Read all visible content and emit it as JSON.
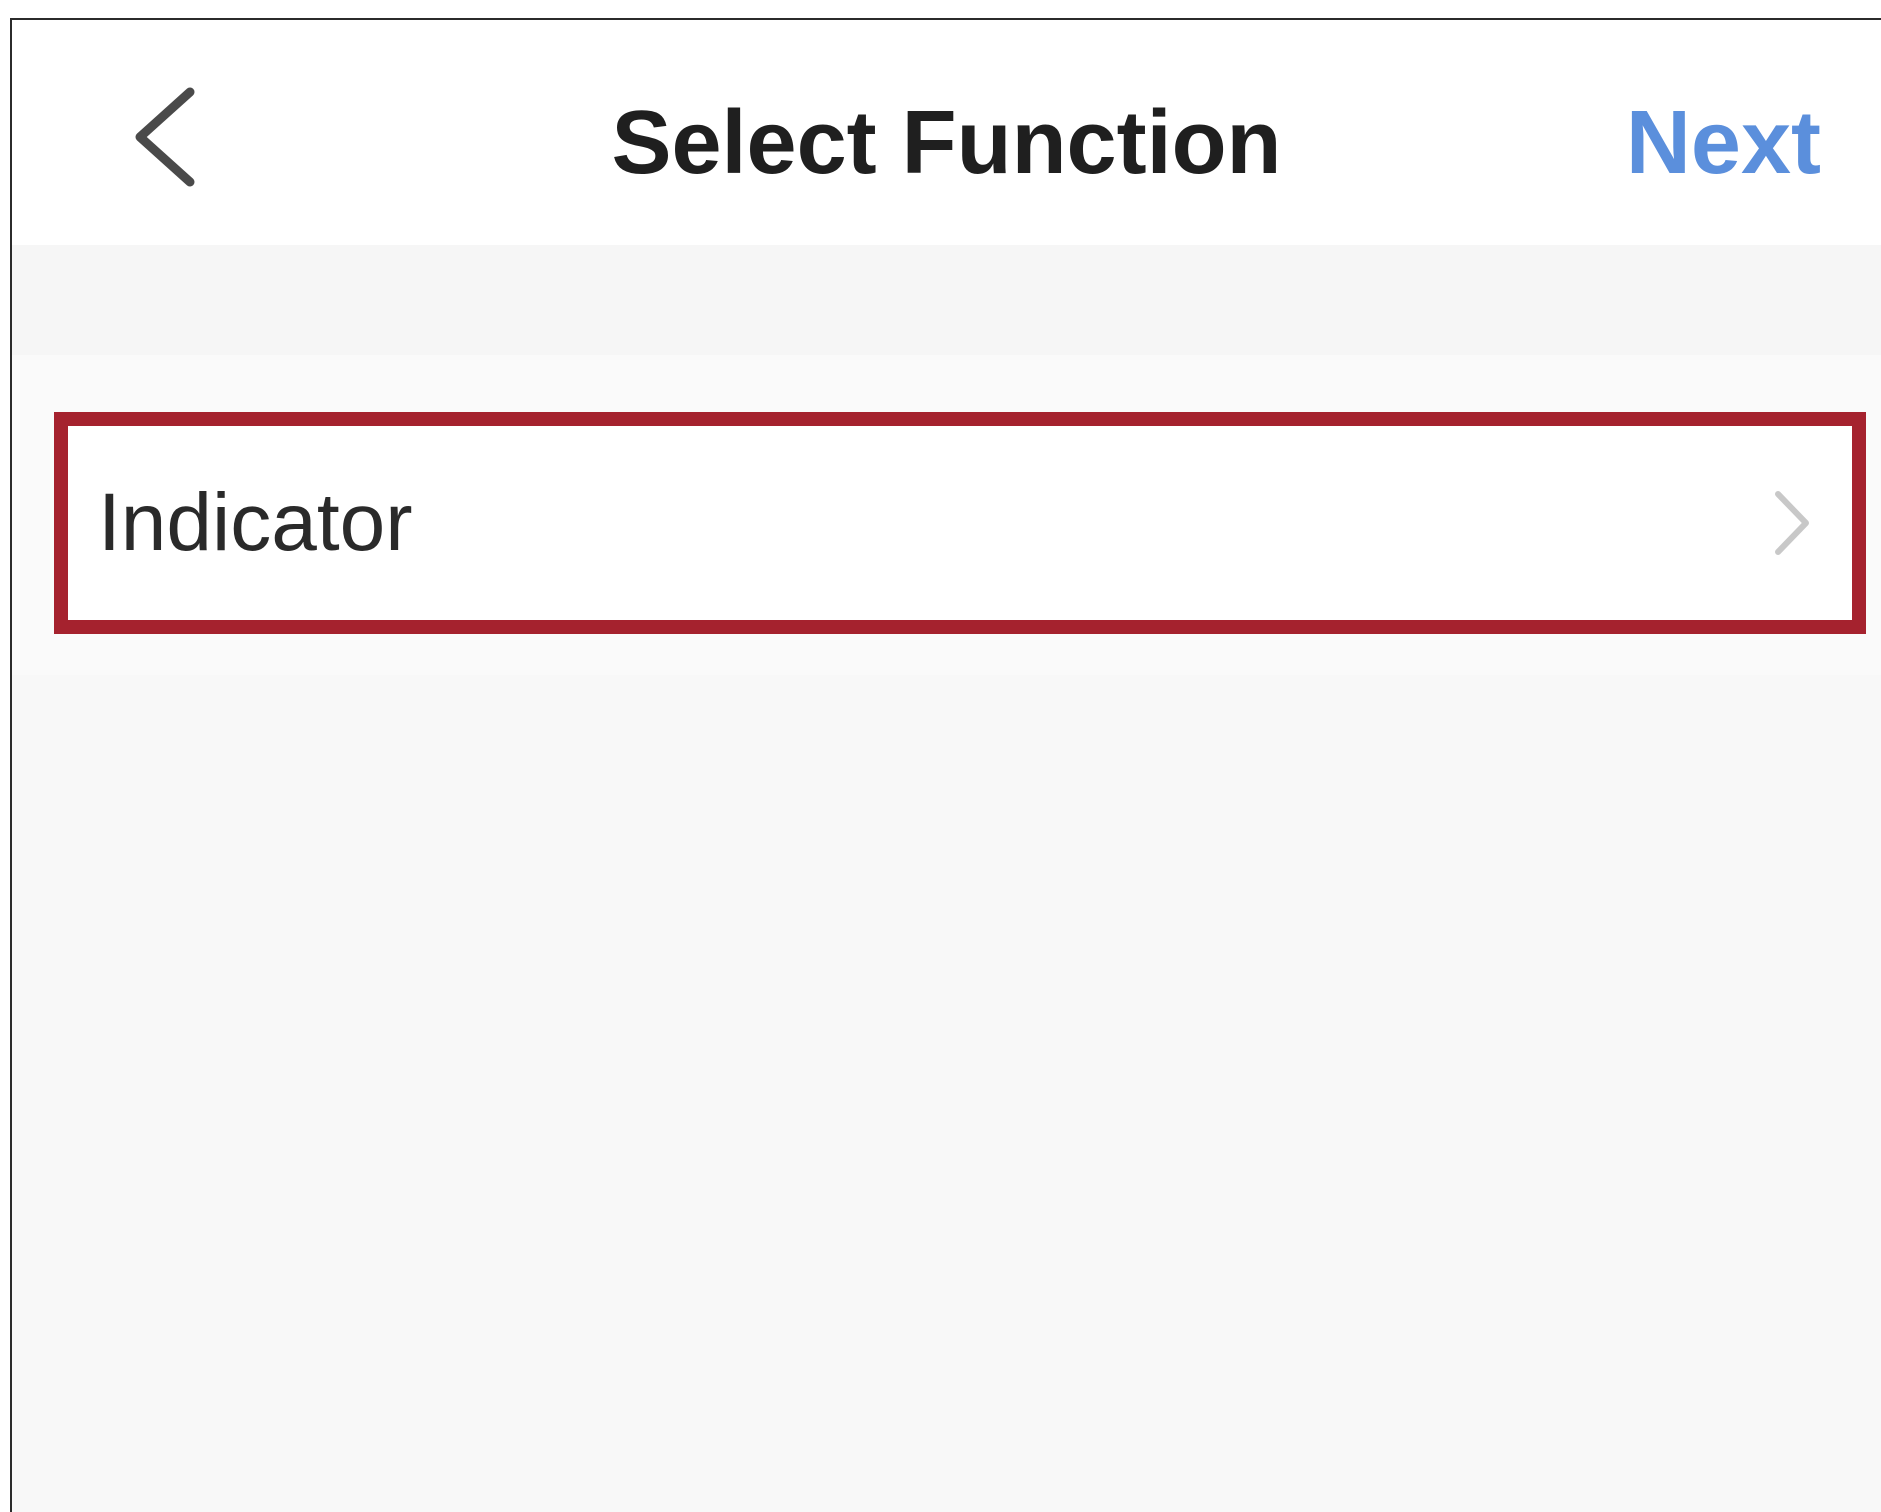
{
  "header": {
    "back_icon": "chevron-left-icon",
    "title": "Select Function",
    "next_label": "Next"
  },
  "function_list": {
    "items": [
      {
        "label": "Indicator",
        "icon": "chevron-right-icon"
      }
    ]
  },
  "colors": {
    "accent": "#5b8fdc",
    "highlight_border": "#a5222e",
    "background": "#f8f8f8",
    "title_text": "#1f1f1f"
  }
}
